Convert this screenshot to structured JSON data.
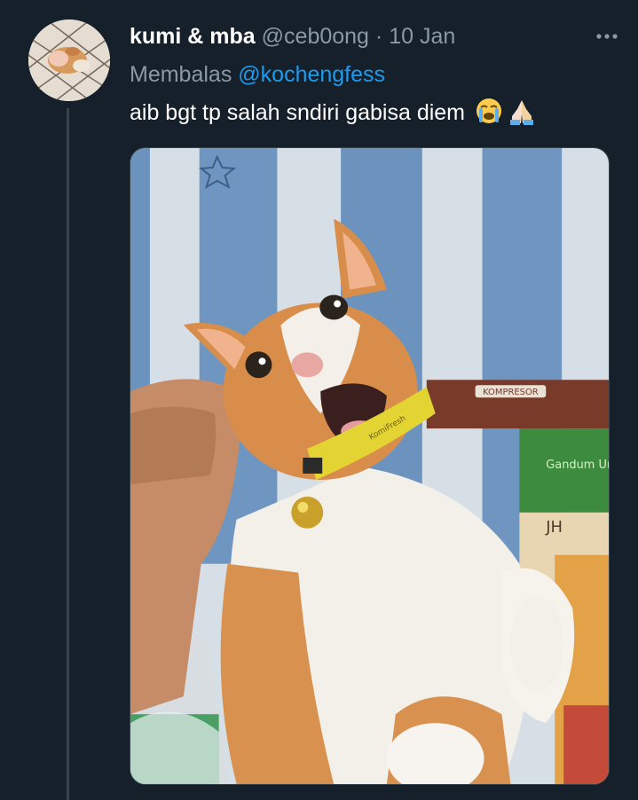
{
  "tweet": {
    "display_name": "kumi & mba",
    "handle": "@ceb0ong",
    "separator": "·",
    "date": "10 Jan",
    "reply_prefix": "Membalas",
    "reply_mention": "@kochengfess",
    "text": "aib bgt tp salah sndiri gabisa diem",
    "emojis": [
      "loudly-crying-face-icon",
      "folded-hands-icon"
    ],
    "more_icon": "more-horizontal-icon"
  },
  "media": {
    "collar_tag_text": "KomiFresh",
    "box_label_1": "KOMPRESOR",
    "box_label_2": "Gandum Uni",
    "box_label_3": "JH"
  },
  "colors": {
    "background": "#15202b",
    "text_primary": "#ffffff",
    "text_secondary": "#8b98a5",
    "link": "#1d9bf0",
    "divider": "#38444d"
  }
}
